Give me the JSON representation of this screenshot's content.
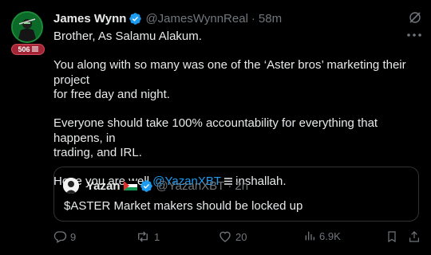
{
  "author": {
    "name": "James Wynn",
    "handle": "@JamesWynnReal",
    "time": "58m",
    "badge_count": "506",
    "badge_icon": "aster-logo-icon"
  },
  "tweet": {
    "lines": [
      "Brother, As Salamu Alakum.",
      "You along with so many was one of the ‘Aster bros’ marketing their project",
      "for free day and night.",
      "Everyone should take 100% accountability for everything that happens, in",
      "trading, and IRL.",
      "Hope you are well"
    ],
    "mention": "@YazanXBT",
    "mention_suffix": "inshallah."
  },
  "quote": {
    "name": "Yazan",
    "handle": "@YazanXBT",
    "time": "2h",
    "text": "$ASTER Market makers should be locked up"
  },
  "actions": {
    "replies": "9",
    "reposts": "1",
    "likes": "20",
    "views": "6.9K"
  },
  "colors": {
    "background": "#000000",
    "text": "#e7e9ea",
    "muted": "#71767b",
    "link": "#1d9bf0",
    "verified": "#1d9bf0",
    "badge": "#a32434"
  }
}
